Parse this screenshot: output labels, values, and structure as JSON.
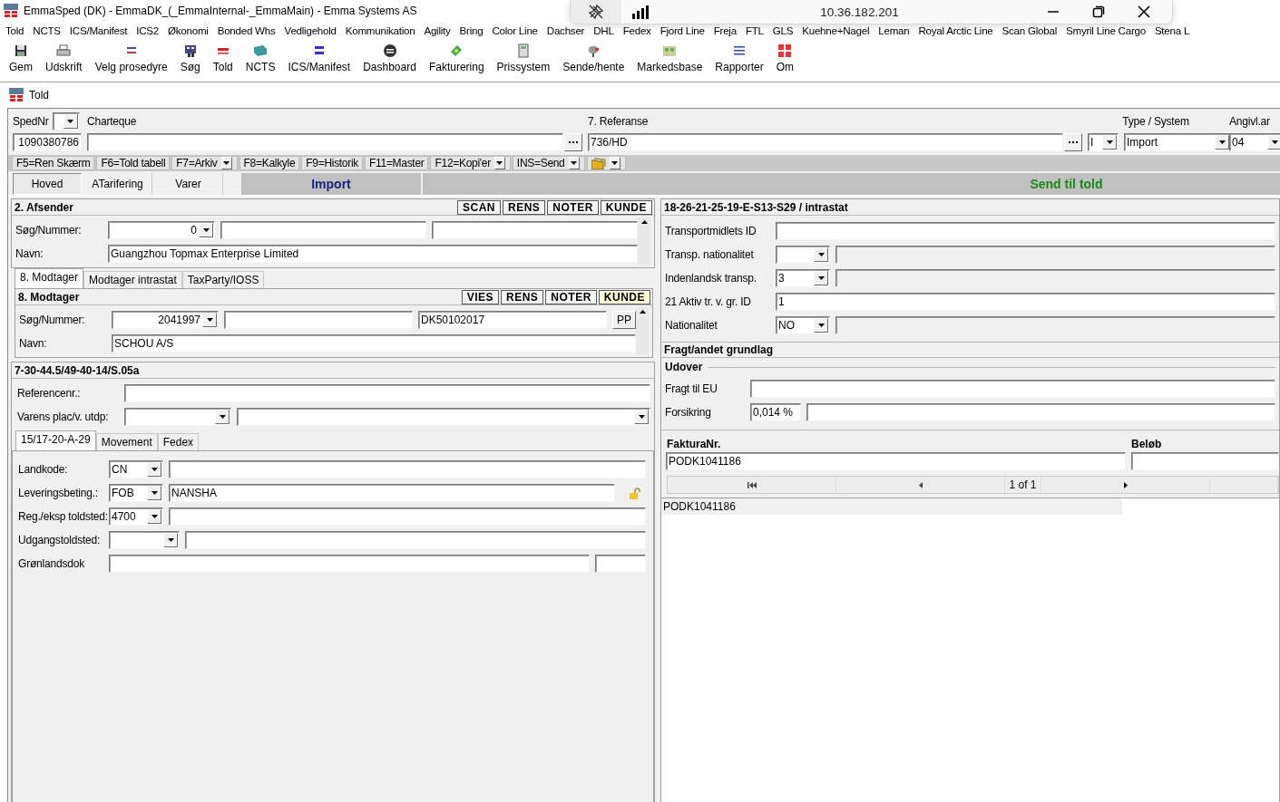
{
  "window": {
    "title": "EmmaSped (DK) - EmmaDK_(_EmmaInternal-_EmmaMain) - Emma Systems AS"
  },
  "remote_bar": {
    "address": "10.36.182.201"
  },
  "menu": [
    "Told",
    "NCTS",
    "ICS/Manifest",
    "ICS2",
    "Økonomi",
    "Bonded Whs",
    "Vedligehold",
    "Kommunikation",
    "Agility",
    "Bring",
    "Color Line",
    "Dachser",
    "DHL",
    "Fedex",
    "Fjord Line",
    "Freja",
    "FTL",
    "GLS",
    "Kuehne+Nagel",
    "Leman",
    "Royal Arctic Line",
    "Scan Global",
    "Smyril Line Cargo",
    "Stena L"
  ],
  "toolbar": [
    "Gem",
    "Udskrift",
    "Velg prosedyre",
    "Søg",
    "Told",
    "NCTS",
    "ICS/Manifest",
    "Dashboard",
    "Fakturering",
    "Prissystem",
    "Sende/hente",
    "Markedsbase",
    "Rapporter",
    "Om"
  ],
  "document": {
    "title": "Told",
    "header": {
      "labels": [
        "SpedNr",
        "Charteque",
        "7. Referanse",
        "Type / System",
        "Angivl.ar"
      ],
      "sped_nr": "1090380786",
      "referanse": "736/HD",
      "type": "I",
      "system": "Import",
      "angivl": "04"
    },
    "function_keys": [
      {
        "kind": "key",
        "label": "F5=Ren Skærm"
      },
      {
        "kind": "key",
        "label": "F6=Told tabell"
      },
      {
        "kind": "split",
        "label": "F7=Arkiv"
      },
      {
        "kind": "key",
        "label": "F8=Kalkyle"
      },
      {
        "kind": "key",
        "label": "F9=Historik"
      },
      {
        "kind": "key",
        "label": "F11=Master"
      },
      {
        "kind": "split",
        "label": "F12=Kopi'er"
      },
      {
        "kind": "split",
        "label": "INS=Send"
      },
      {
        "kind": "icon-split"
      }
    ],
    "tabs": [
      {
        "label": "Hoved",
        "selected": true
      },
      {
        "label": "ATarifering",
        "selected": false
      },
      {
        "label": "Varer",
        "selected": false
      }
    ],
    "mode": "Import",
    "send_button": "Send til told"
  },
  "afsender": {
    "title": "2. Afsender",
    "buttons": [
      {
        "label": "SCAN",
        "highlighted": false
      },
      {
        "label": "RENS",
        "highlighted": false
      },
      {
        "label": "NOTER",
        "highlighted": false
      },
      {
        "label": "KUNDE",
        "highlighted": false
      }
    ],
    "rows": [
      {
        "label": "Søg/Nummer:",
        "fields": [
          {
            "kind": "number-combo",
            "value": "0"
          },
          {
            "kind": "text"
          },
          {
            "kind": "text"
          }
        ]
      },
      {
        "label": "Navn:",
        "fields": [
          {
            "kind": "text",
            "value": "Guangzhou Topmax Enterprise Limited"
          }
        ]
      }
    ]
  },
  "recipient_tabs": [
    {
      "label": "8. Modtager",
      "selected": true
    },
    {
      "label": "Modtager intrastat",
      "selected": false
    },
    {
      "label": "TaxParty/IOSS",
      "selected": false
    }
  ],
  "modtager": {
    "title": "8. Modtager",
    "buttons": [
      {
        "label": "VIES",
        "highlighted": false
      },
      {
        "label": "RENS",
        "highlighted": false
      },
      {
        "label": "NOTER",
        "highlighted": false
      },
      {
        "label": "KUNDE",
        "highlighted": true
      }
    ],
    "rows": [
      {
        "label": "Søg/Nummer:",
        "fields": [
          {
            "kind": "number-combo",
            "value": "2041997"
          },
          {
            "kind": "text"
          },
          {
            "kind": "text",
            "value": "DK50102017"
          },
          {
            "kind": "button",
            "value": "PP"
          }
        ]
      },
      {
        "label": "Navn:",
        "fields": [
          {
            "kind": "text",
            "value": "SCHOU A/S"
          }
        ]
      }
    ]
  },
  "location": {
    "title": "7-30-44.5/49-40-14/S.05a",
    "rows": [
      {
        "label": "Referencenr.:",
        "fields": [
          {
            "kind": "text"
          }
        ]
      },
      {
        "label": "Varens plac/v. utdp:",
        "fields": [
          {
            "kind": "long-combo"
          },
          {
            "kind": "grow-combo"
          }
        ]
      }
    ]
  },
  "goods_tabs": [
    {
      "label": "15/17-20-A-29",
      "selected": true
    },
    {
      "label": "Movement",
      "selected": false
    },
    {
      "label": "Fedex",
      "selected": false
    }
  ],
  "goods": {
    "rows": [
      {
        "label": "Landkode:",
        "fields": [
          {
            "kind": "combo",
            "value": "CN"
          },
          {
            "kind": "text"
          }
        ]
      },
      {
        "label": "Leveringsbeting.:",
        "fields": [
          {
            "kind": "combo",
            "value": "FOB"
          },
          {
            "kind": "text",
            "value": "NANSHA"
          },
          {
            "kind": "lock"
          }
        ]
      },
      {
        "label": "Reg./eksp toldsted:",
        "fields": [
          {
            "kind": "combo",
            "value": "4700"
          },
          {
            "kind": "text"
          }
        ]
      },
      {
        "label": "Udgangstoldsted:",
        "fields": [
          {
            "kind": "mid-combo"
          },
          {
            "kind": "text"
          }
        ]
      },
      {
        "label": "Grønlandsdok",
        "fields": [
          {
            "kind": "text"
          },
          {
            "kind": "short"
          }
        ]
      }
    ]
  },
  "transport": {
    "title": "18-26-21-25-19-E-S13-S29 / intrastat",
    "rows": [
      {
        "label": "Transportmidlets ID",
        "fields": [
          {
            "kind": "text",
            "disabled": false
          }
        ]
      },
      {
        "label": "Transp. nationalitet",
        "fields": [
          {
            "kind": "combo",
            "disabled": false
          },
          {
            "kind": "text",
            "disabled": true
          }
        ]
      },
      {
        "label": "Indenlandsk transp.",
        "fields": [
          {
            "kind": "combo",
            "value": "3",
            "disabled": false
          },
          {
            "kind": "text",
            "disabled": true
          }
        ]
      },
      {
        "label": "21 Aktiv tr. v. gr. ID",
        "fields": [
          {
            "kind": "text",
            "value": "1",
            "disabled": false
          }
        ]
      },
      {
        "label": "Nationalitet",
        "fields": [
          {
            "kind": "combo",
            "value": "NO",
            "disabled": false
          },
          {
            "kind": "text",
            "disabled": true
          }
        ]
      }
    ]
  },
  "freight": {
    "title": "Fragt/andet grundlag",
    "group": "Udover",
    "rows": [
      {
        "label": "Fragt til EU",
        "fields": [
          {
            "kind": "text"
          }
        ]
      },
      {
        "label": "Forsikring",
        "fields": [
          {
            "kind": "short",
            "value": "0,014 %"
          },
          {
            "kind": "text"
          }
        ]
      }
    ]
  },
  "invoices": {
    "columns": [
      "FakturaNr.",
      "Beløb"
    ],
    "invoice_no": "PODK1041186",
    "position": "1 of 1",
    "rows": [
      [
        "PODK1041186"
      ]
    ]
  }
}
